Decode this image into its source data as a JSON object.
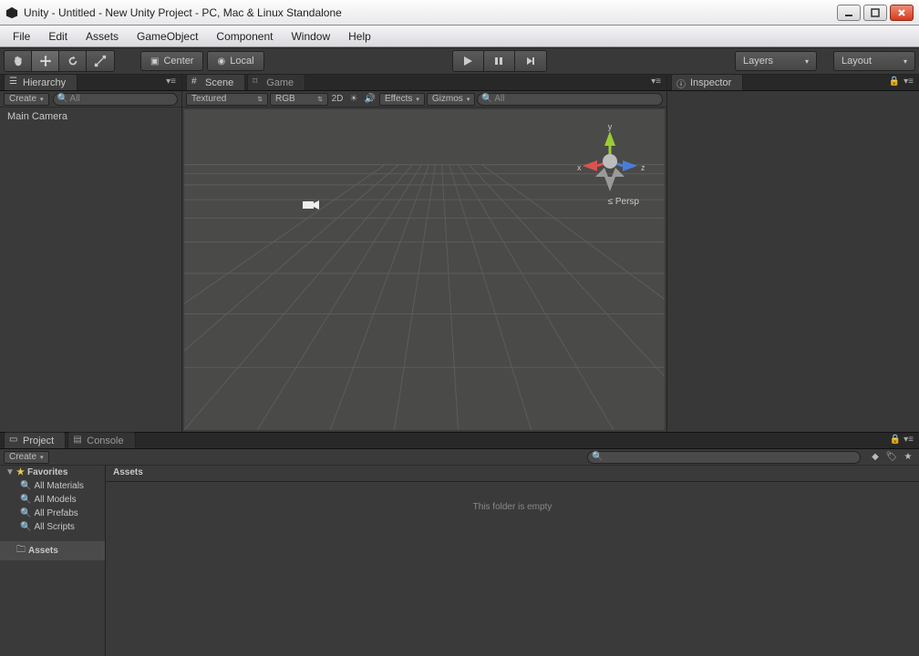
{
  "window": {
    "title": "Unity - Untitled - New Unity Project - PC, Mac & Linux Standalone"
  },
  "menu": {
    "items": [
      "File",
      "Edit",
      "Assets",
      "GameObject",
      "Component",
      "Window",
      "Help"
    ]
  },
  "toolbar": {
    "pivot_label": "Center",
    "space_label": "Local",
    "layers_label": "Layers",
    "layout_label": "Layout"
  },
  "panels": {
    "hierarchy": {
      "title": "Hierarchy",
      "create_label": "Create",
      "search_placeholder": "All",
      "items": [
        "Main Camera"
      ]
    },
    "scene": {
      "tab_scene": "Scene",
      "tab_game": "Game",
      "shading_label": "Textured",
      "rendermode_label": "RGB",
      "twod_label": "2D",
      "effects_label": "Effects",
      "gizmos_label": "Gizmos",
      "search_placeholder": "All",
      "persp_label": "Persp",
      "axes": {
        "x": "x",
        "y": "y",
        "z": "z"
      }
    },
    "inspector": {
      "title": "Inspector"
    },
    "project": {
      "tab_project": "Project",
      "tab_console": "Console",
      "create_label": "Create",
      "favorites_label": "Favorites",
      "fav_items": [
        "All Materials",
        "All Models",
        "All Prefabs",
        "All Scripts"
      ],
      "assets_label": "Assets",
      "breadcrumb": "Assets",
      "empty_msg": "This folder is empty"
    }
  }
}
